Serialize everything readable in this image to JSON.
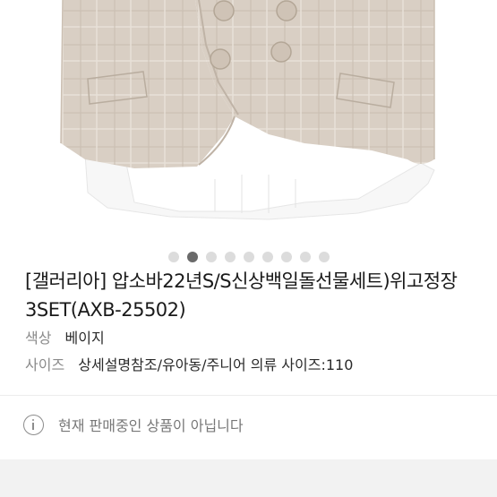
{
  "carousel": {
    "total": 9,
    "active": 1
  },
  "product": {
    "title": "[갤러리아] 압소바22년S/S신상백일돌선물세트)위고정장3SET(AXB-25502)",
    "color_label": "색상",
    "color_value": "베이지",
    "size_label": "사이즈",
    "size_value": "상세설명참조/유아동/주니어 의류 사이즈:110"
  },
  "notice": {
    "icon": "info-icon",
    "text": "현재 판매중인 상품이 아닙니다"
  },
  "colors": {
    "vest": "#d9cfc4",
    "active_dot": "#6a6a6a",
    "inactive_dot": "#dcdcdc"
  }
}
